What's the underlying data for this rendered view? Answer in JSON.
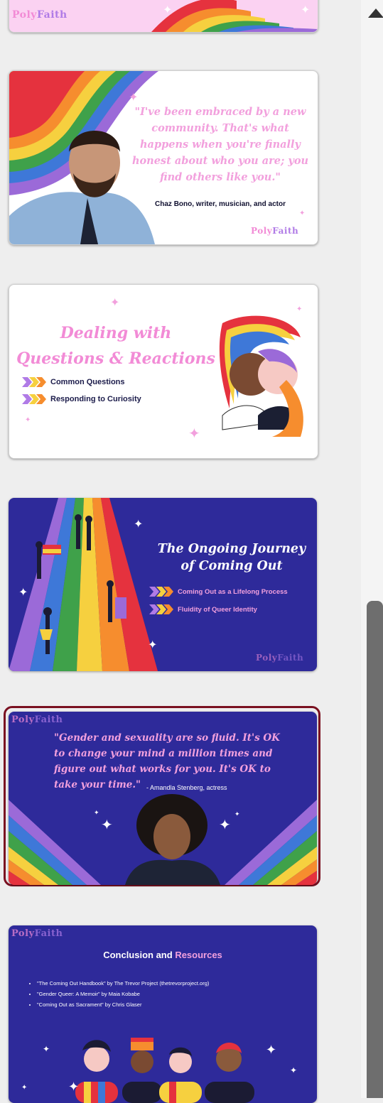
{
  "colors": {
    "navy": "#2e2a9a",
    "pink": "#f28bd6",
    "selected_border": "#7a1020"
  },
  "logo": {
    "part_a": "Poly",
    "part_b": "Faith"
  },
  "slides": [
    {
      "id": "top-partial",
      "selected": false
    },
    {
      "id": "chaz-quote",
      "selected": false,
      "quote": "\"I've been embraced by a new community. That's what happens when you're finally honest about who you are; you find others like you.\"",
      "attribution": "Chaz Bono, writer, musician, and actor"
    },
    {
      "id": "dealing-questions",
      "selected": false,
      "title_line1": "Dealing with",
      "title_line2": "Questions & Reactions",
      "bullets": [
        "Common Questions",
        "Responding to Curiosity"
      ]
    },
    {
      "id": "ongoing-journey",
      "selected": false,
      "title_line1": "The Ongoing Journey",
      "title_line2": "of Coming Out",
      "bullets": [
        "Coming Out as a Lifelong Process",
        "Fluidity of Queer Identity"
      ]
    },
    {
      "id": "amandla-quote",
      "selected": true,
      "quote": "\"Gender and sexuality are so fluid. It's OK to change your mind a million times and figure out what works for you. It's OK to take your time.\"",
      "attribution": "- Amandla Stenberg, actress"
    },
    {
      "id": "conclusion",
      "selected": false,
      "title_a": "Conclusion and",
      "title_b": "Resources",
      "resources": [
        "\"The Coming Out Handbook\" by The Trevor Project (thetrevorproject.org)",
        "\"Gender Queer: A Memoir\" by Maia Kobabe",
        "\"Coming Out as Sacrament\" by Chris Glaser"
      ]
    }
  ]
}
